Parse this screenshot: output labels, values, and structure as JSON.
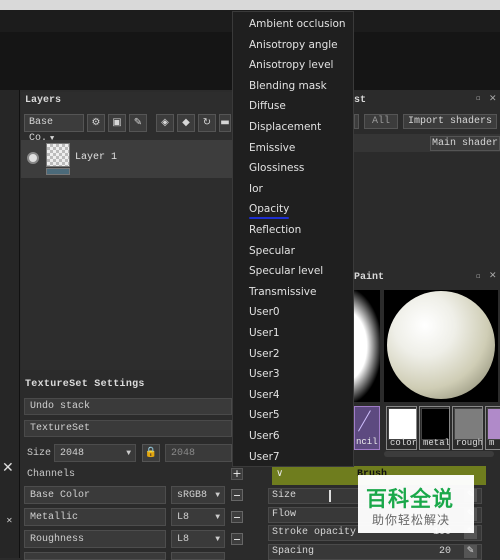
{
  "layers_panel": {
    "title": "Layers",
    "blend_mode": "Base Co.",
    "layer_name": "Layer 1"
  },
  "shelf_panel": {
    "title_fragment": "st",
    "filter_all": "All",
    "import_button": "Import shaders",
    "item": "Main shader"
  },
  "paint_panel": {
    "title_fragment": "Paint",
    "thumb_label_fragment": "ncil",
    "swatches": [
      {
        "label": "color",
        "color": "#ffffff"
      },
      {
        "label": "metal",
        "color": "#000000"
      },
      {
        "label": "rough",
        "color": "#7d7d7d"
      },
      {
        "label": "m",
        "color": "#b08ac9"
      }
    ],
    "section_fragment": "Brush",
    "props": [
      {
        "label": "Size",
        "value": ""
      },
      {
        "label": "Flow",
        "value": ""
      },
      {
        "label": "Stroke opacity",
        "value": "100"
      },
      {
        "label": "Spacing",
        "value": "20"
      }
    ]
  },
  "textureset": {
    "title": "TextureSet Settings",
    "undo_stack": "Undo stack",
    "textureset_label": "TextureSet",
    "size_label": "Size",
    "size_value": "2048",
    "size_value2": "2048",
    "channels_label": "Channels",
    "channels": [
      {
        "name": "Base Color",
        "format": "sRGB8"
      },
      {
        "name": "Metallic",
        "format": "L8"
      },
      {
        "name": "Roughness",
        "format": "L8"
      }
    ]
  },
  "channel_menu": {
    "items": [
      "Ambient occlusion",
      "Anisotropy angle",
      "Anisotropy level",
      "Blending mask",
      "Diffuse",
      "Displacement",
      "Emissive",
      "Glossiness",
      "Ior",
      "Opacity",
      "Reflection",
      "Specular",
      "Specular level",
      "Transmissive",
      "User0",
      "User1",
      "User2",
      "User3",
      "User4",
      "User5",
      "User6",
      "User7"
    ],
    "highlighted": "Opacity"
  },
  "watermark": {
    "title": "百科全说",
    "subtitle": "助你轻松解决"
  },
  "colors": {
    "accent_green": "#6f7d1e",
    "underline_blue": "#1e2fd0",
    "watermark_green": "#1aa84a"
  }
}
